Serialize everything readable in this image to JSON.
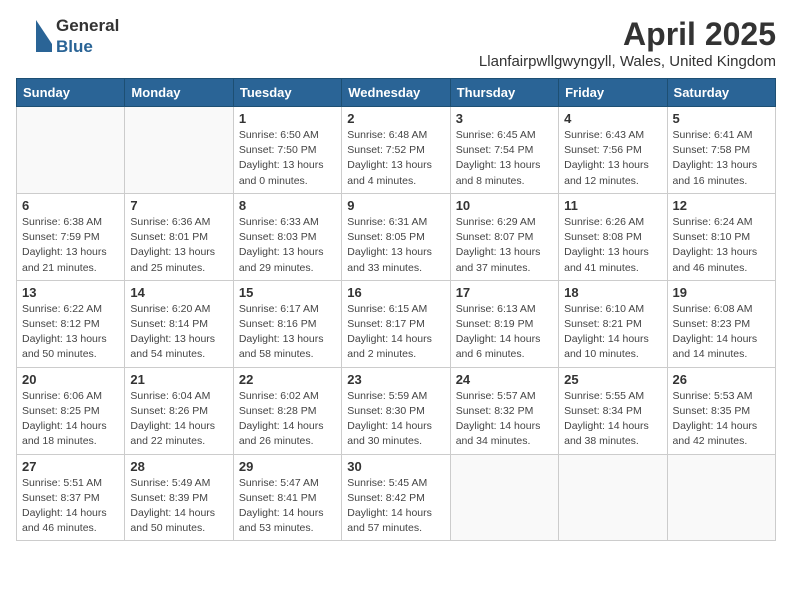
{
  "logo": {
    "general": "General",
    "blue": "Blue",
    "tagline": ""
  },
  "title": "April 2025",
  "location": "Llanfairpwllgwyngyll, Wales, United Kingdom",
  "weekdays": [
    "Sunday",
    "Monday",
    "Tuesday",
    "Wednesday",
    "Thursday",
    "Friday",
    "Saturday"
  ],
  "weeks": [
    [
      {
        "day": "",
        "info": ""
      },
      {
        "day": "",
        "info": ""
      },
      {
        "day": "1",
        "info": "Sunrise: 6:50 AM\nSunset: 7:50 PM\nDaylight: 13 hours and 0 minutes."
      },
      {
        "day": "2",
        "info": "Sunrise: 6:48 AM\nSunset: 7:52 PM\nDaylight: 13 hours and 4 minutes."
      },
      {
        "day": "3",
        "info": "Sunrise: 6:45 AM\nSunset: 7:54 PM\nDaylight: 13 hours and 8 minutes."
      },
      {
        "day": "4",
        "info": "Sunrise: 6:43 AM\nSunset: 7:56 PM\nDaylight: 13 hours and 12 minutes."
      },
      {
        "day": "5",
        "info": "Sunrise: 6:41 AM\nSunset: 7:58 PM\nDaylight: 13 hours and 16 minutes."
      }
    ],
    [
      {
        "day": "6",
        "info": "Sunrise: 6:38 AM\nSunset: 7:59 PM\nDaylight: 13 hours and 21 minutes."
      },
      {
        "day": "7",
        "info": "Sunrise: 6:36 AM\nSunset: 8:01 PM\nDaylight: 13 hours and 25 minutes."
      },
      {
        "day": "8",
        "info": "Sunrise: 6:33 AM\nSunset: 8:03 PM\nDaylight: 13 hours and 29 minutes."
      },
      {
        "day": "9",
        "info": "Sunrise: 6:31 AM\nSunset: 8:05 PM\nDaylight: 13 hours and 33 minutes."
      },
      {
        "day": "10",
        "info": "Sunrise: 6:29 AM\nSunset: 8:07 PM\nDaylight: 13 hours and 37 minutes."
      },
      {
        "day": "11",
        "info": "Sunrise: 6:26 AM\nSunset: 8:08 PM\nDaylight: 13 hours and 41 minutes."
      },
      {
        "day": "12",
        "info": "Sunrise: 6:24 AM\nSunset: 8:10 PM\nDaylight: 13 hours and 46 minutes."
      }
    ],
    [
      {
        "day": "13",
        "info": "Sunrise: 6:22 AM\nSunset: 8:12 PM\nDaylight: 13 hours and 50 minutes."
      },
      {
        "day": "14",
        "info": "Sunrise: 6:20 AM\nSunset: 8:14 PM\nDaylight: 13 hours and 54 minutes."
      },
      {
        "day": "15",
        "info": "Sunrise: 6:17 AM\nSunset: 8:16 PM\nDaylight: 13 hours and 58 minutes."
      },
      {
        "day": "16",
        "info": "Sunrise: 6:15 AM\nSunset: 8:17 PM\nDaylight: 14 hours and 2 minutes."
      },
      {
        "day": "17",
        "info": "Sunrise: 6:13 AM\nSunset: 8:19 PM\nDaylight: 14 hours and 6 minutes."
      },
      {
        "day": "18",
        "info": "Sunrise: 6:10 AM\nSunset: 8:21 PM\nDaylight: 14 hours and 10 minutes."
      },
      {
        "day": "19",
        "info": "Sunrise: 6:08 AM\nSunset: 8:23 PM\nDaylight: 14 hours and 14 minutes."
      }
    ],
    [
      {
        "day": "20",
        "info": "Sunrise: 6:06 AM\nSunset: 8:25 PM\nDaylight: 14 hours and 18 minutes."
      },
      {
        "day": "21",
        "info": "Sunrise: 6:04 AM\nSunset: 8:26 PM\nDaylight: 14 hours and 22 minutes."
      },
      {
        "day": "22",
        "info": "Sunrise: 6:02 AM\nSunset: 8:28 PM\nDaylight: 14 hours and 26 minutes."
      },
      {
        "day": "23",
        "info": "Sunrise: 5:59 AM\nSunset: 8:30 PM\nDaylight: 14 hours and 30 minutes."
      },
      {
        "day": "24",
        "info": "Sunrise: 5:57 AM\nSunset: 8:32 PM\nDaylight: 14 hours and 34 minutes."
      },
      {
        "day": "25",
        "info": "Sunrise: 5:55 AM\nSunset: 8:34 PM\nDaylight: 14 hours and 38 minutes."
      },
      {
        "day": "26",
        "info": "Sunrise: 5:53 AM\nSunset: 8:35 PM\nDaylight: 14 hours and 42 minutes."
      }
    ],
    [
      {
        "day": "27",
        "info": "Sunrise: 5:51 AM\nSunset: 8:37 PM\nDaylight: 14 hours and 46 minutes."
      },
      {
        "day": "28",
        "info": "Sunrise: 5:49 AM\nSunset: 8:39 PM\nDaylight: 14 hours and 50 minutes."
      },
      {
        "day": "29",
        "info": "Sunrise: 5:47 AM\nSunset: 8:41 PM\nDaylight: 14 hours and 53 minutes."
      },
      {
        "day": "30",
        "info": "Sunrise: 5:45 AM\nSunset: 8:42 PM\nDaylight: 14 hours and 57 minutes."
      },
      {
        "day": "",
        "info": ""
      },
      {
        "day": "",
        "info": ""
      },
      {
        "day": "",
        "info": ""
      }
    ]
  ]
}
